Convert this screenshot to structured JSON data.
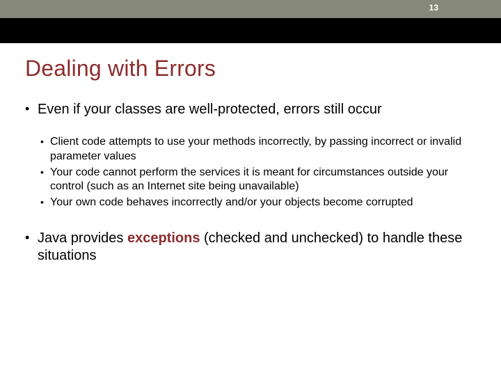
{
  "slide_number": "13",
  "title": "Dealing with Errors",
  "bullets_lvl1": {
    "item0": "Even if your classes are well-protected, errors still occur",
    "item1_pre": "Java provides ",
    "item1_accent": "exceptions",
    "item1_post": " (checked and unchecked) to handle these situations"
  },
  "bullets_lvl2": {
    "item0": "Client code attempts to use your methods incorrectly, by passing incorrect or invalid parameter values",
    "item1": "Your code cannot perform the services it is meant for circumstances outside your control (such as an Internet site being unavailable)",
    "item2": "Your own code behaves incorrectly and/or your objects become corrupted"
  }
}
